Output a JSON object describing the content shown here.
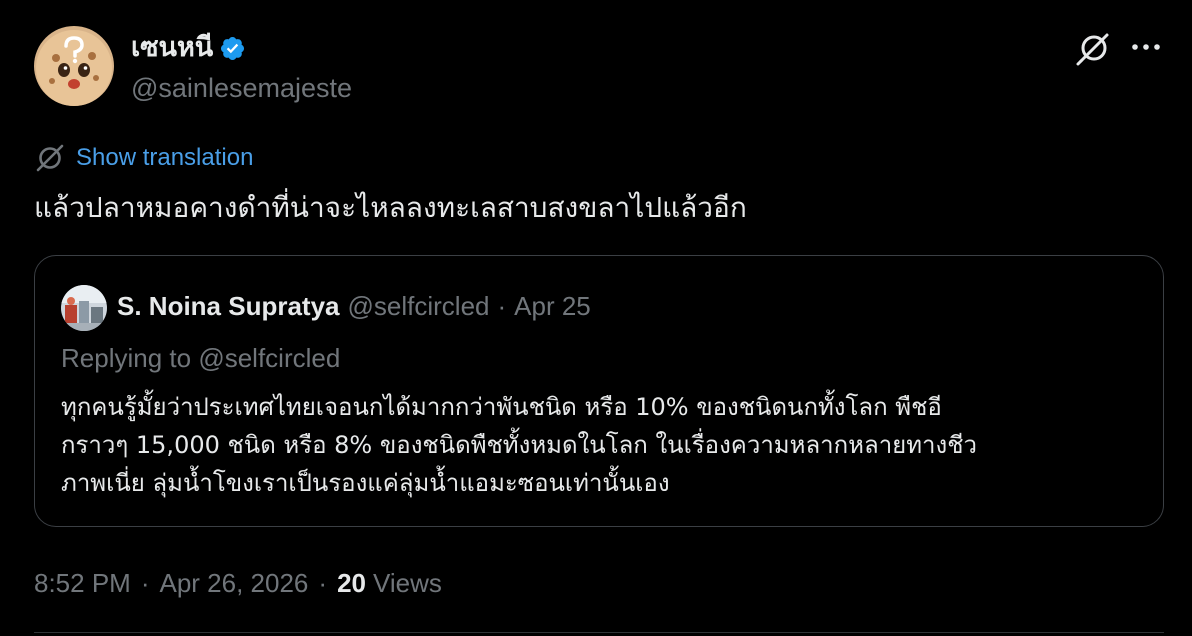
{
  "author": {
    "display_name": "เซนหนี",
    "handle": "@sainlesemajeste",
    "verified": true,
    "avatar_icon": "cookie-face-avatar"
  },
  "actions": {
    "grok_icon": "grok-icon",
    "more_icon": "more-options-icon"
  },
  "translation": {
    "label": "Show translation",
    "icon": "translate-icon"
  },
  "tweet": {
    "text": "แล้วปลาหมอคางดำที่น่าจะไหลลงทะเลสาบสงขลาไปแล้วอีก"
  },
  "quote": {
    "display_name": "S. Noina Supratya",
    "handle": "@selfcircled",
    "separator": "·",
    "date": "Apr 25",
    "replying_prefix": "Replying to",
    "replying_handle": "@selfcircled",
    "text_lines": [
      "ทุกคนรู้มั้ยว่าประเทศไทยเจอนกได้มากกว่าพันชนิด หรือ 10% ของชนิดนกทั้งโลก พืชอี",
      "กราวๆ 15,000 ชนิด หรือ 8% ของชนิดพืชทั้งหมดในโลก ในเรื่องความหลากหลายทางชีว",
      "ภาพเนี่ย ลุ่มน้ำโขงเราเป็นรองแค่ลุ่มน้ำแอมะซอนเท่านั้นเอง"
    ]
  },
  "meta": {
    "time": "8:52 PM",
    "separator": "·",
    "date": "Apr 26, 2026",
    "views_count": "20",
    "views_label": "Views"
  },
  "colors": {
    "background": "#000000",
    "text_primary": "#e7e9ea",
    "text_secondary": "#71767b",
    "link": "#4a9fe8",
    "verified": "#1d9bf0",
    "border": "#3b3f44"
  }
}
